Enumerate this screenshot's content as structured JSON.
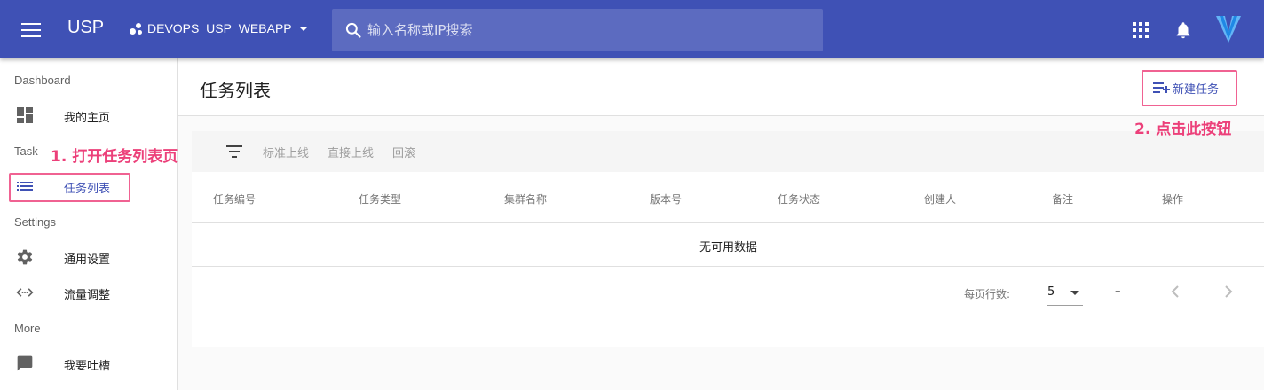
{
  "appbar": {
    "title": "USP",
    "project": "DEVOPS_USP_WEBAPP",
    "search_placeholder": "输入名称或IP搜索",
    "icons": [
      "menu-icon",
      "apps-icon",
      "bell-icon",
      "vuetify-logo-icon"
    ],
    "color": "#3f51b5"
  },
  "sidebar": {
    "sections": [
      {
        "header": "Dashboard",
        "items": [
          {
            "label": "我的主页",
            "icon": "dashboard-icon"
          }
        ]
      },
      {
        "header": "Task",
        "items": [
          {
            "label": "任务列表",
            "icon": "list-icon",
            "active": true
          }
        ]
      },
      {
        "header": "Settings",
        "items": [
          {
            "label": "通用设置",
            "icon": "gear-icon"
          },
          {
            "label": "流量调整",
            "icon": "code-arrows-icon"
          }
        ]
      },
      {
        "header": "More",
        "items": [
          {
            "label": "我要吐槽",
            "icon": "chat-icon"
          }
        ]
      }
    ]
  },
  "annotations": {
    "step1": "1. 打开任务列表页",
    "step2": "2. 点击此按钮",
    "color": "#ec407a"
  },
  "page": {
    "title": "任务列表",
    "new_task_label": "新建任务",
    "toolbar": {
      "buttons": [
        "标准上线",
        "直接上线",
        "回滚"
      ]
    },
    "table": {
      "columns": [
        "任务编号",
        "任务类型",
        "集群名称",
        "版本号",
        "任务状态",
        "创建人",
        "备注",
        "操作"
      ],
      "rows": [],
      "empty_text": "无可用数据"
    },
    "pagination": {
      "rows_per_page_label": "每页行数:",
      "rows_per_page": "5",
      "range": "–"
    }
  }
}
